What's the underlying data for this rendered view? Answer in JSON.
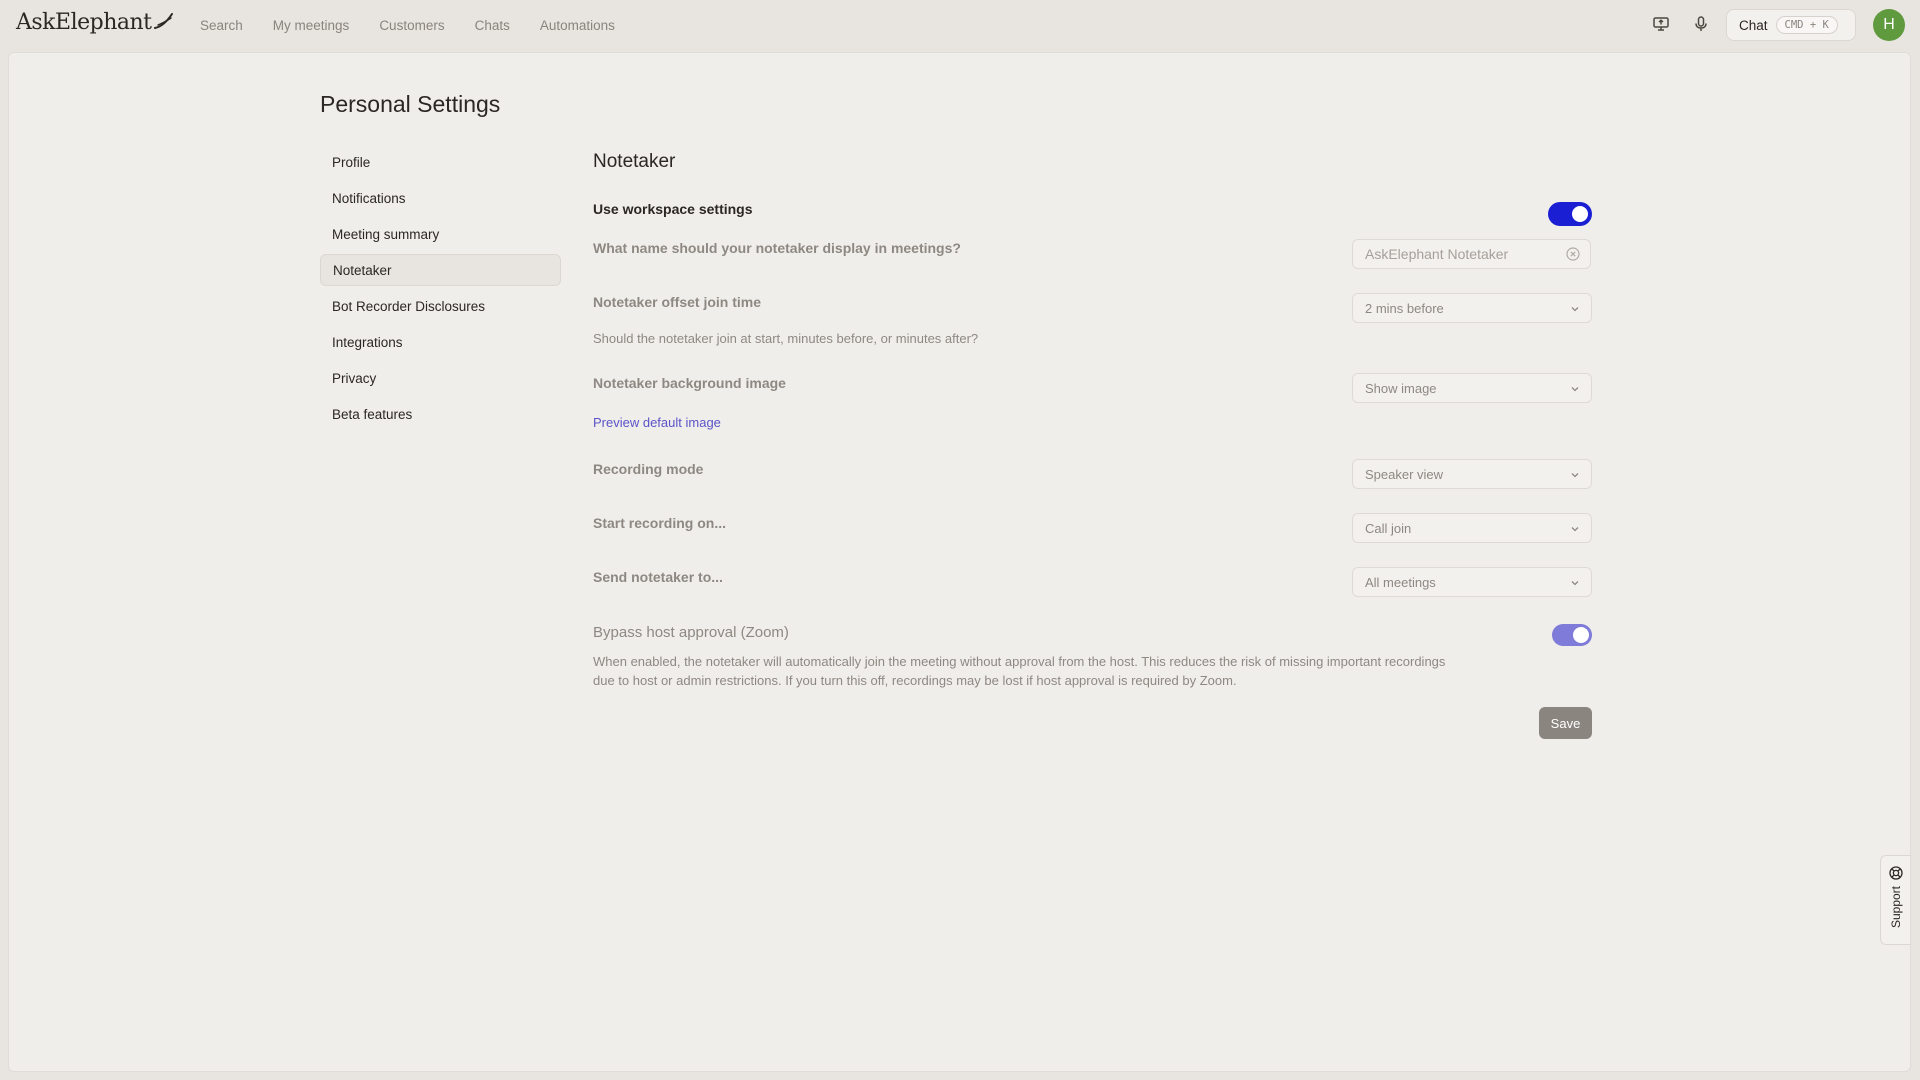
{
  "app": {
    "brand": "AskElephant"
  },
  "nav": {
    "items": [
      "Search",
      "My meetings",
      "Customers",
      "Chats",
      "Automations"
    ]
  },
  "topbar": {
    "chat_label": "Chat",
    "chat_shortcut": "CMD + K",
    "avatar_initial": "H"
  },
  "page": {
    "title": "Personal Settings"
  },
  "sidebar": {
    "items": [
      {
        "label": "Profile",
        "active": false
      },
      {
        "label": "Notifications",
        "active": false
      },
      {
        "label": "Meeting summary",
        "active": false
      },
      {
        "label": "Notetaker",
        "active": true
      },
      {
        "label": "Bot Recorder Disclosures",
        "active": false
      },
      {
        "label": "Integrations",
        "active": false
      },
      {
        "label": "Privacy",
        "active": false
      },
      {
        "label": "Beta features",
        "active": false
      }
    ]
  },
  "notetaker": {
    "title": "Notetaker",
    "use_workspace": {
      "label": "Use workspace settings",
      "on": true
    },
    "display_name": {
      "label": "What name should your notetaker display in meetings?",
      "placeholder": "AskElephant Notetaker"
    },
    "offset": {
      "label": "Notetaker offset join time",
      "value": "2 mins before",
      "help": "Should the notetaker join at start, minutes before, or minutes after?"
    },
    "background": {
      "label": "Notetaker background image",
      "value": "Show image",
      "link": "Preview default image"
    },
    "recording_mode": {
      "label": "Recording mode",
      "value": "Speaker view"
    },
    "start_recording": {
      "label": "Start recording on...",
      "value": "Call join"
    },
    "send_to": {
      "label": "Send notetaker to...",
      "value": "All meetings"
    },
    "bypass": {
      "label": "Bypass host approval (Zoom)",
      "on": true,
      "help_line1": "When enabled, the notetaker will automatically join the meeting without approval from the host. This reduces the risk of missing important recordings",
      "help_line2": "due to host or admin restrictions. If you turn this off, recordings may be lost if host approval is required by Zoom."
    },
    "save_label": "Save"
  },
  "support": {
    "label": "Support"
  },
  "colors": {
    "toggle_on": "#1a1fd4",
    "toggle_dim": "#7f7bd8",
    "avatar": "#5f9a3f",
    "link": "#5a54c8"
  }
}
